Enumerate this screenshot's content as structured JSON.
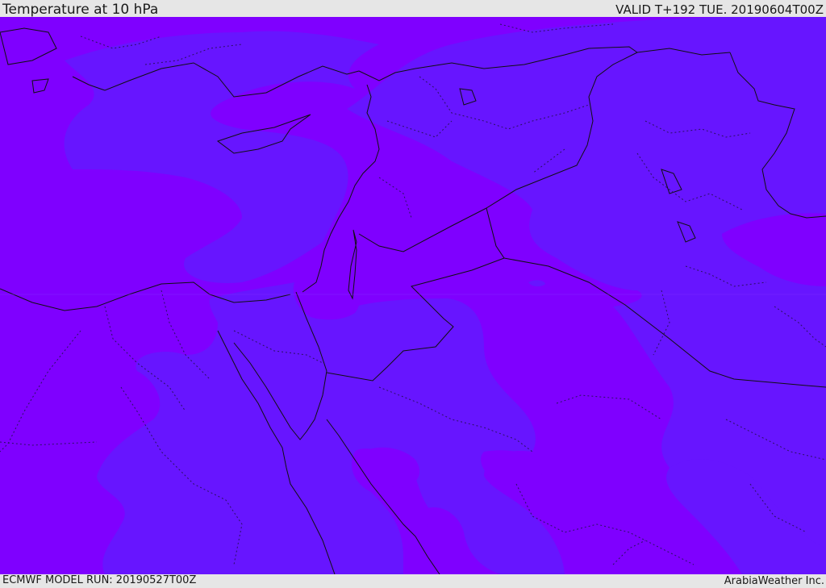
{
  "header": {
    "title": "Temperature at 10 hPa",
    "valid": "VALID T+192 TUE. 20190604T00Z"
  },
  "footer": {
    "model_run": "ECMWF MODEL RUN: 20190527T00Z",
    "credit": "ArabiaWeather Inc."
  },
  "map": {
    "field": "temperature",
    "level": "10 hPa",
    "colors": {
      "band_warm": "#7f00ff",
      "band_cool": "#6715ff",
      "border": "#101010",
      "coast": "#101010",
      "admin_boundary": "#2a1060"
    }
  }
}
